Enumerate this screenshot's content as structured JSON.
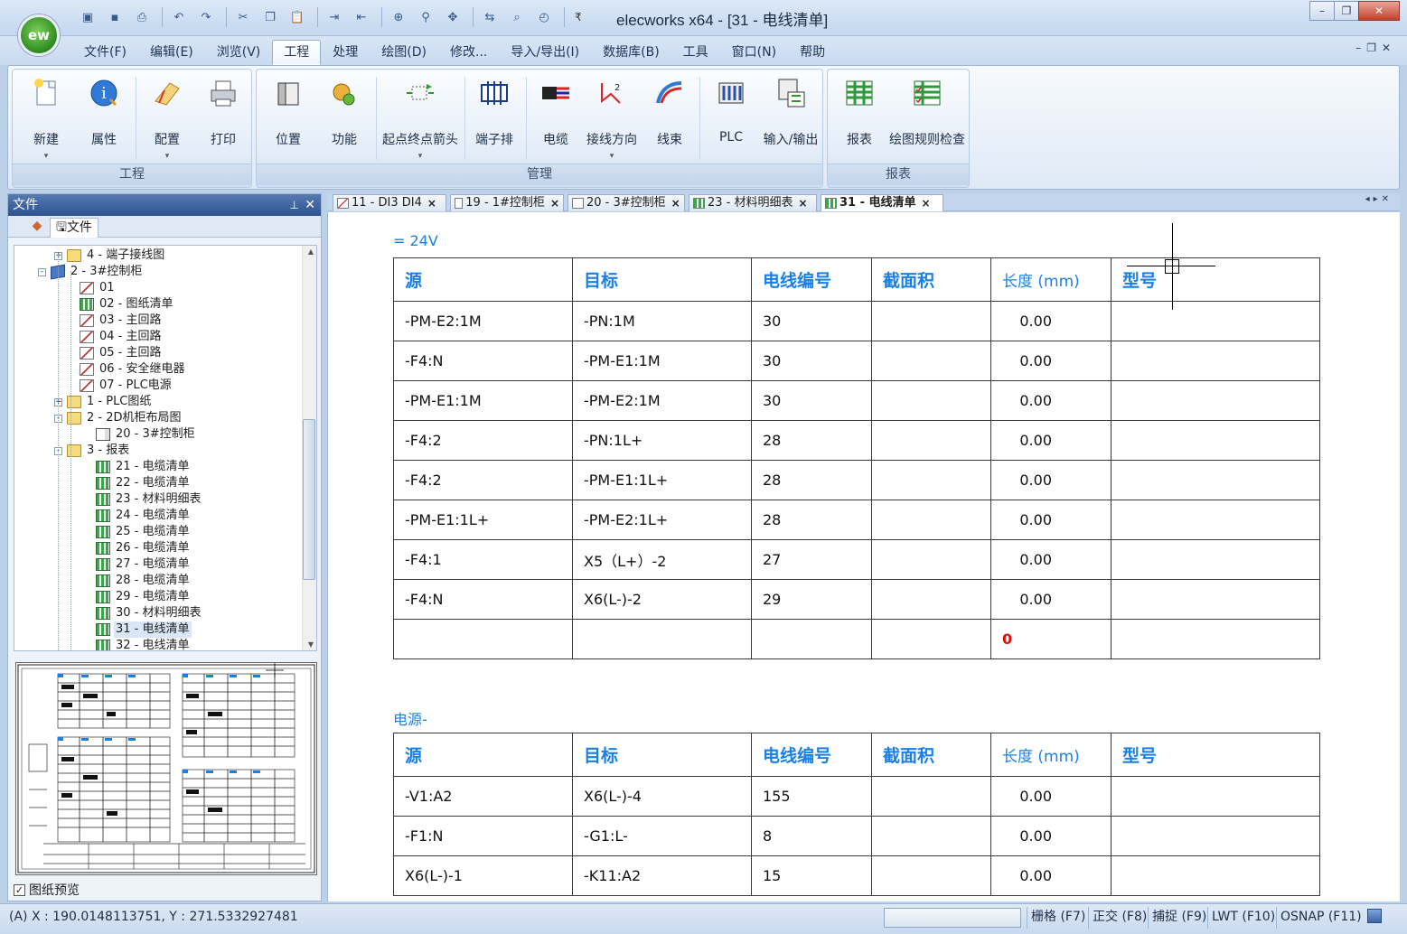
{
  "app": {
    "logo_text": "ew",
    "window_title": "elecworks x64 - [31 - 电线清单]"
  },
  "qat": {
    "more": "₹"
  },
  "menus": [
    "文件(F)",
    "编辑(E)",
    "浏览(V)",
    "工程",
    "处理",
    "绘图(D)",
    "修改...",
    "导入/导出(I)",
    "数据库(B)",
    "工具",
    "窗口(N)",
    "帮助"
  ],
  "active_menu": "工程",
  "ribbon": {
    "groups": [
      {
        "label": "工程",
        "buttons": [
          "新建",
          "属性",
          "配置",
          "打印"
        ]
      },
      {
        "label": "管理",
        "buttons": [
          "位置",
          "功能",
          "起点终点箭头",
          "端子排",
          "电缆",
          "接线方向",
          "线束",
          "PLC",
          "输入/输出"
        ]
      },
      {
        "label": "报表",
        "buttons": [
          "报表",
          "绘图规则检查"
        ]
      }
    ]
  },
  "left_panel": {
    "title": "文件",
    "tab_label": "文件",
    "tree": [
      {
        "label": "4 - 端子接线图",
        "icon": "folder-icon",
        "expand": "+"
      },
      {
        "label": "2 - 3#控制柜",
        "icon": "book-icon",
        "expand": "-"
      },
      {
        "label": "01",
        "icon": "drawing-icon"
      },
      {
        "label": "02 - 图纸清单",
        "icon": "report-icon"
      },
      {
        "label": "03 - 主回路",
        "icon": "drawing-icon"
      },
      {
        "label": "04 - 主回路",
        "icon": "drawing-icon"
      },
      {
        "label": "05 - 主回路",
        "icon": "drawing-icon"
      },
      {
        "label": "06 - 安全继电器",
        "icon": "drawing-icon"
      },
      {
        "label": "07 - PLC电源",
        "icon": "drawing-icon"
      },
      {
        "label": "1 - PLC图纸",
        "icon": "folder-icon",
        "expand": "+"
      },
      {
        "label": "2 - 2D机柜布局图",
        "icon": "folder-icon",
        "expand": "-"
      },
      {
        "label": "20 - 3#控制柜",
        "icon": "cabinet-icon"
      },
      {
        "label": "3 - 报表",
        "icon": "folder-icon",
        "expand": "-"
      },
      {
        "label": "21 - 电缆清单",
        "icon": "report-icon"
      },
      {
        "label": "22 - 电缆清单",
        "icon": "report-icon"
      },
      {
        "label": "23 - 材料明细表",
        "icon": "report-icon"
      },
      {
        "label": "24 - 电缆清单",
        "icon": "report-icon"
      },
      {
        "label": "25 - 电缆清单",
        "icon": "report-icon"
      },
      {
        "label": "26 - 电缆清单",
        "icon": "report-icon"
      },
      {
        "label": "27 - 电缆清单",
        "icon": "report-icon"
      },
      {
        "label": "28 - 电缆清单",
        "icon": "report-icon"
      },
      {
        "label": "29 - 电缆清单",
        "icon": "report-icon"
      },
      {
        "label": "30 - 材料明细表",
        "icon": "report-icon"
      },
      {
        "label": "31 - 电线清单",
        "icon": "report-icon",
        "selected": true
      },
      {
        "label": "32 - 电线清单",
        "icon": "report-icon"
      }
    ],
    "preview_checkbox": "图纸预览",
    "preview_checked": "✓"
  },
  "doc_tabs": [
    {
      "label": "11 - DI3 DI4",
      "icon": "drawing-icon"
    },
    {
      "label": "19 - 1#控制柜",
      "icon": "cabinet-icon"
    },
    {
      "label": "20 - 3#控制柜",
      "icon": "cabinet-icon"
    },
    {
      "label": "23 - 材料明细表",
      "icon": "report-icon"
    },
    {
      "label": "31 - 电线清单",
      "icon": "report-icon",
      "active": true
    }
  ],
  "tab_close": "×",
  "tables": [
    {
      "title": "=  24V",
      "headers": [
        "源",
        "目标",
        "电线编号",
        "截面积",
        "长度 (mm)",
        "型号"
      ],
      "rows": [
        [
          "-PM-E2:1M",
          "-PN:1M",
          "30",
          "",
          "0.00",
          ""
        ],
        [
          "-F4:N",
          "-PM-E1:1M",
          "30",
          "",
          "0.00",
          ""
        ],
        [
          "-PM-E1:1M",
          "-PM-E2:1M",
          "30",
          "",
          "0.00",
          ""
        ],
        [
          "-F4:2",
          "-PN:1L+",
          "28",
          "",
          "0.00",
          ""
        ],
        [
          "-F4:2",
          "-PM-E1:1L+",
          "28",
          "",
          "0.00",
          ""
        ],
        [
          "-PM-E1:1L+",
          "-PM-E2:1L+",
          "28",
          "",
          "0.00",
          ""
        ],
        [
          "-F4:1",
          "X5（L+）-2",
          "27",
          "",
          "0.00",
          ""
        ],
        [
          "-F4:N",
          "X6(L-)-2",
          "29",
          "",
          "0.00",
          ""
        ]
      ],
      "total": "0"
    },
    {
      "title": "电源-",
      "headers": [
        "源",
        "目标",
        "电线编号",
        "截面积",
        "长度 (mm)",
        "型号"
      ],
      "rows": [
        [
          "-V1:A2",
          "X6(L-)-4",
          "155",
          "",
          "0.00",
          ""
        ],
        [
          "-F1:N",
          "-G1:L-",
          "8",
          "",
          "0.00",
          ""
        ],
        [
          "X6(L-)-1",
          "-K11:A2",
          "15",
          "",
          "0.00",
          ""
        ]
      ]
    }
  ],
  "status": {
    "coords": "(A) X : 190.0148113751, Y : 271.5332927481",
    "toggles": [
      "栅格 (F7)",
      "正交 (F8)",
      "捕捉 (F9)",
      "LWT (F10)",
      "OSNAP (F11)"
    ]
  },
  "colors": {
    "header_blue": "#1a7fe6",
    "total_red": "#e01010",
    "panel_title": "#2d5290"
  }
}
